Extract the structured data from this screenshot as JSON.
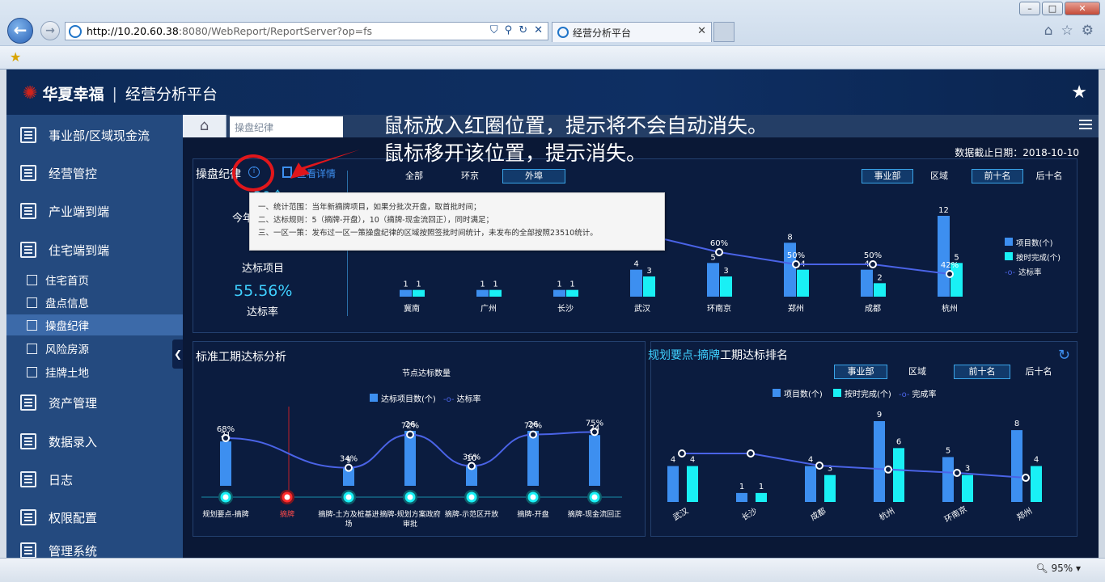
{
  "browser": {
    "url_host": "http://10.20.60.38",
    "url_rest": ":8080/WebReport/ReportServer?op=fs",
    "tab_title": "经营分析平台",
    "zoom": "95%"
  },
  "app": {
    "brand": "华夏幸福",
    "separator": "|",
    "platform": "经营分析平台"
  },
  "sidebar": {
    "items": [
      {
        "label": "事业部/区域现金流"
      },
      {
        "label": "经营管控"
      },
      {
        "label": "产业端到端"
      },
      {
        "label": "住宅端到端"
      },
      {
        "label": "资产管理"
      },
      {
        "label": "数据录入"
      },
      {
        "label": "日志"
      },
      {
        "label": "权限配置"
      },
      {
        "label": "管理系统"
      }
    ],
    "subitems": [
      {
        "label": "住宅首页"
      },
      {
        "label": "盘点信息"
      },
      {
        "label": "操盘纪律"
      },
      {
        "label": "风险房源"
      },
      {
        "label": "挂牌土地"
      }
    ]
  },
  "topbar": {
    "breadcrumb": "操盘纪律"
  },
  "annotation": {
    "line1": "鼠标放入红圈位置，提示将不会自动消失。",
    "line2": "鼠标移开该位置，提示消失。"
  },
  "report": {
    "date_label": "数据截止日期：2018-10-10",
    "panel1": {
      "title": "操盘纪律",
      "detail_link": "查看详情",
      "info_icon": "i",
      "kpi_partial1": "30个",
      "kpi_partial2": "今年",
      "kpi_partial3": "2",
      "kpi_label_projects": "达标项目",
      "kpi_rate": "55.56%",
      "kpi_label_rate": "达标率",
      "filters": [
        "全部",
        "环京",
        "外埠"
      ],
      "filter_selected": 2,
      "toggle1": [
        "事业部",
        "区域"
      ],
      "toggle2": [
        "前十名",
        "后十名"
      ],
      "legend": [
        "项目数(个)",
        "按时完成(个)",
        "达标率"
      ]
    },
    "tooltip": {
      "line1": "一、统计范围：当年新摘牌项目，如果分批次开盘，取首批时间；",
      "line2": "二、达标规则：5（摘牌-开盘），10（摘牌-现金流回正），同时满足；",
      "line3": "三、一区一策：发布过一区一策操盘纪律的区域按照签批时间统计，未发布的全部按照23510统计。"
    },
    "panel2": {
      "title": "标准工期达标分析",
      "subtitle": "节点达标数量",
      "legend": [
        "达标项目数(个)",
        "达标率"
      ]
    },
    "panel3": {
      "title_a": "规划要点-摘牌",
      "title_b": "工期达标排名",
      "toggle1": [
        "事业部",
        "区域"
      ],
      "toggle2": [
        "前十名",
        "后十名"
      ],
      "legend": [
        "项目数(个)",
        "按时完成(个)",
        "完成率"
      ]
    }
  },
  "chart_data": [
    {
      "type": "bar",
      "name": "top",
      "categories": [
        "冀南",
        "广州",
        "长沙",
        "武汉",
        "环南京",
        "郑州",
        "成都",
        "杭州"
      ],
      "series": [
        {
          "name": "项目数(个)",
          "values": [
            1,
            1,
            1,
            4,
            5,
            8,
            4,
            12
          ],
          "color": "#3d8ff0"
        },
        {
          "name": "按时完成(个)",
          "values": [
            1,
            1,
            1,
            3,
            3,
            4,
            2,
            5
          ],
          "color": "#19f0f5"
        },
        {
          "name": "达标率",
          "values": [
            null,
            null,
            null,
            75,
            60,
            50,
            50,
            42
          ],
          "labels": [
            "",
            "",
            "",
            "75%",
            "60%",
            "50%",
            "50%",
            "42%"
          ],
          "color": "#4a63e6"
        }
      ]
    },
    {
      "type": "bar",
      "name": "bottom-left",
      "categories": [
        "规划要点-摘牌",
        "摘牌",
        "摘牌-土方及桩基进场",
        "摘牌-规划方案政府审批",
        "摘牌-示范区开放",
        "摘牌-开盘",
        "摘牌-现金流回正"
      ],
      "series": [
        {
          "name": "达标项目数(个)",
          "values": [
            21,
            null,
            9,
            26,
            10,
            26,
            24
          ],
          "labels": [
            "21",
            "",
            "9",
            "26",
            "10",
            "26",
            "24"
          ],
          "color": "#3d8ff0"
        },
        {
          "name": "达标率",
          "values": [
            68,
            null,
            34,
            72,
            36,
            72,
            75
          ],
          "labels": [
            "68%",
            "",
            "34%",
            "72%",
            "36%",
            "72%",
            "75%"
          ],
          "color": "#4a63e6"
        }
      ]
    },
    {
      "type": "bar",
      "name": "bottom-right",
      "categories": [
        "武汉",
        "长沙",
        "成都",
        "杭州",
        "环南京",
        "郑州"
      ],
      "series": [
        {
          "name": "项目数(个)",
          "values": [
            4,
            1,
            4,
            9,
            5,
            8
          ],
          "color": "#3d8ff0"
        },
        {
          "name": "按时完成(个)",
          "values": [
            4,
            1,
            3,
            6,
            3,
            4
          ],
          "color": "#19f0f5"
        },
        {
          "name": "完成率",
          "values": [
            100,
            100,
            75,
            67,
            60,
            50
          ],
          "color": "#4a63e6"
        }
      ]
    }
  ]
}
